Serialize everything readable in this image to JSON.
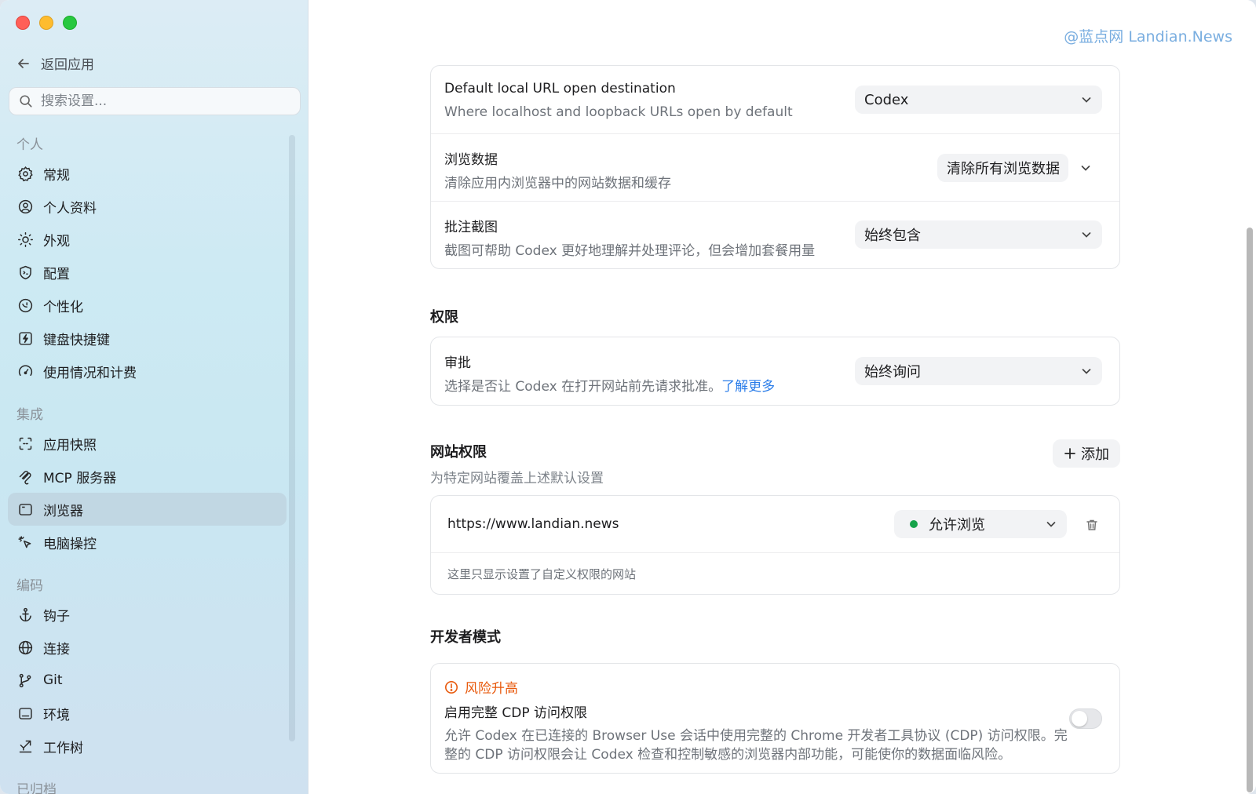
{
  "colors": {
    "accent_link": "#2b7de9",
    "risk": "#e8590c",
    "status_green": "#16a34a",
    "watermark": "#7aaee0"
  },
  "watermark": "@蓝点网 Landian.News",
  "sidebar": {
    "back_label": "返回应用",
    "search_placeholder": "搜索设置...",
    "groups": [
      {
        "label": "个人",
        "items": [
          {
            "label": "常规",
            "icon": "gear-icon"
          },
          {
            "label": "个人资料",
            "icon": "person-circle-icon"
          },
          {
            "label": "外观",
            "icon": "sun-icon"
          },
          {
            "label": "配置",
            "icon": "shield-icon"
          },
          {
            "label": "个性化",
            "icon": "personalization-icon"
          },
          {
            "label": "键盘快捷键",
            "icon": "keyboard-shortcut-icon"
          },
          {
            "label": "使用情况和计费",
            "icon": "gauge-icon"
          }
        ]
      },
      {
        "label": "集成",
        "items": [
          {
            "label": "应用快照",
            "icon": "snapshot-icon"
          },
          {
            "label": "MCP 服务器",
            "icon": "mcp-icon"
          },
          {
            "label": "浏览器",
            "icon": "browser-icon",
            "active": true
          },
          {
            "label": "电脑操控",
            "icon": "cursor-click-icon"
          }
        ]
      },
      {
        "label": "编码",
        "items": [
          {
            "label": "钩子",
            "icon": "anchor-icon"
          },
          {
            "label": "连接",
            "icon": "globe-icon"
          },
          {
            "label": "Git",
            "icon": "git-branch-icon"
          },
          {
            "label": "环境",
            "icon": "terminal-icon"
          },
          {
            "label": "工作树",
            "icon": "worktree-icon"
          }
        ]
      },
      {
        "label": "已归档",
        "items": []
      }
    ]
  },
  "browser_card": {
    "local_url": {
      "title": "Default local URL open destination",
      "desc": "Where localhost and loopback URLs open by default",
      "value": "Codex"
    },
    "browsing_data": {
      "title": "浏览数据",
      "desc": "清除应用内浏览器中的网站数据和缓存",
      "button": "清除所有浏览数据"
    },
    "screenshots": {
      "title": "批注截图",
      "desc": "截图可帮助 Codex 更好地理解并处理评论，但会增加套餐用量",
      "value": "始终包含"
    }
  },
  "permissions": {
    "heading": "权限",
    "approval": {
      "title": "审批",
      "desc": "选择是否让 Codex 在打开网站前先请求批准。",
      "link": "了解更多",
      "value": "始终询问"
    }
  },
  "site_permissions": {
    "heading": "网站权限",
    "sub": "为特定网站覆盖上述默认设置",
    "add_label": "添加",
    "sites": [
      {
        "url": "https://www.landian.news",
        "status": "允许浏览"
      }
    ],
    "footnote": "这里只显示设置了自定义权限的网站"
  },
  "developer": {
    "heading": "开发者模式",
    "risk_label": "风险升高",
    "cdp_title": "启用完整 CDP 访问权限",
    "cdp_desc_line1": "允许 Codex 在已连接的 Browser Use 会话中使用完整的 Chrome 开发者工具协议 (CDP) 访问权限。完",
    "cdp_desc_line2": "整的 CDP 访问权限会让 Codex 检查和控制敏感的浏览器内部功能，可能使你的数据面临风险。",
    "cdp_enabled": false
  }
}
